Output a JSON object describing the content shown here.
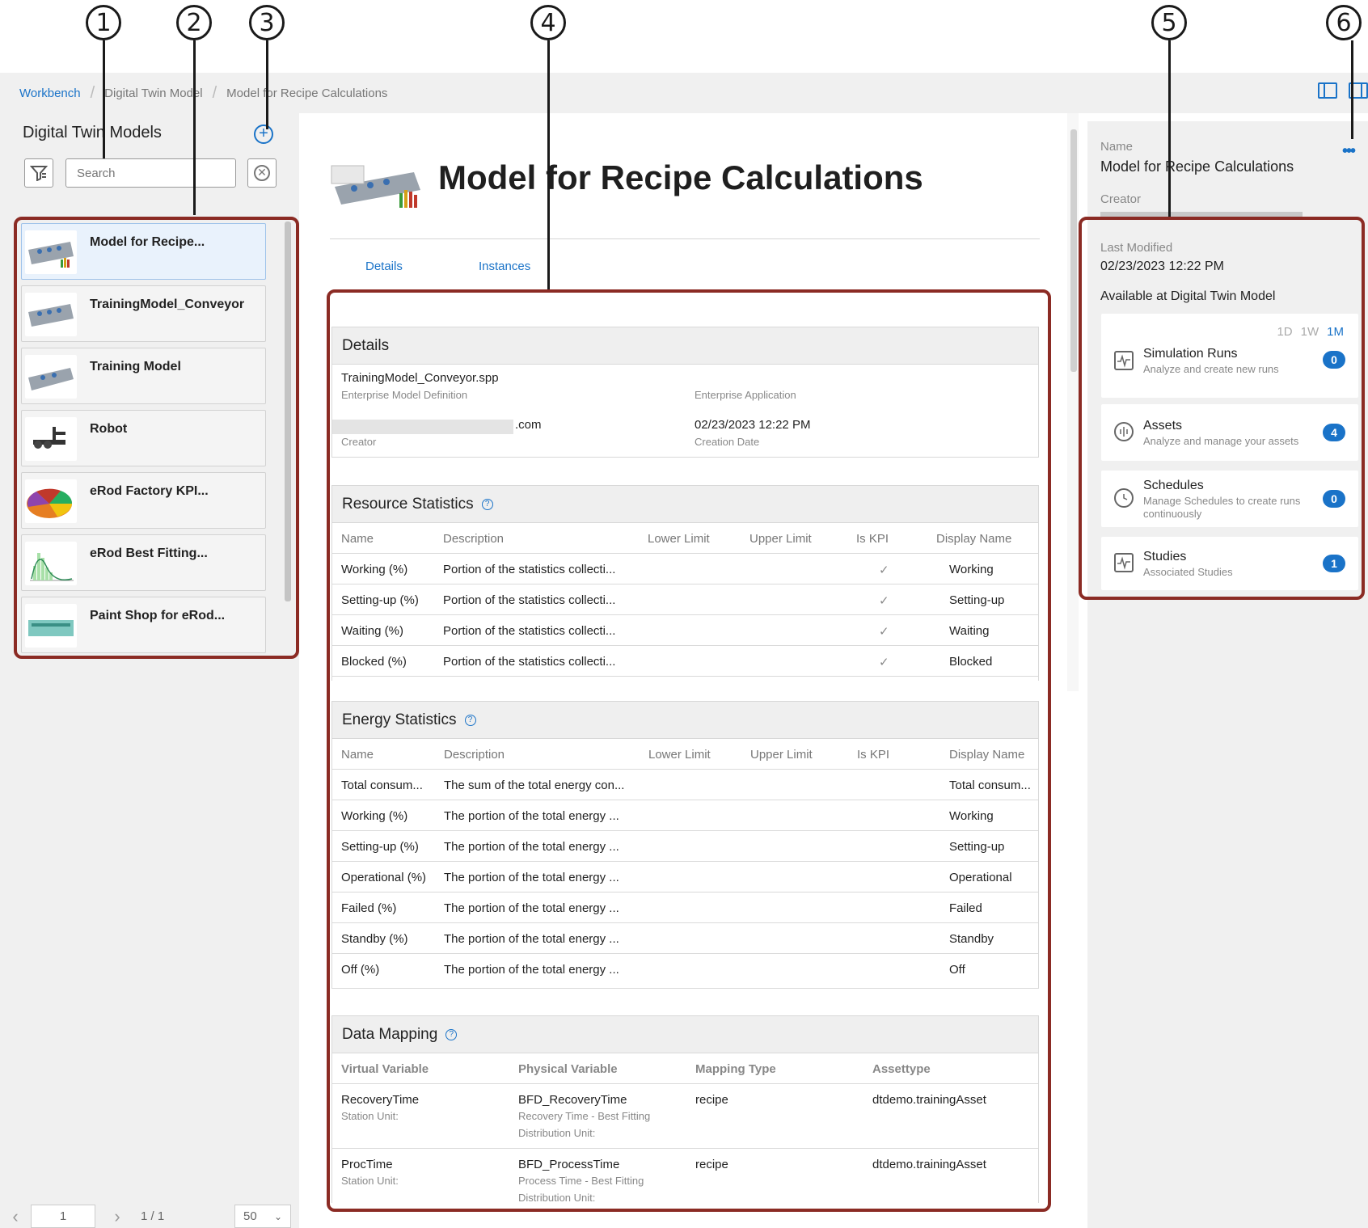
{
  "callouts": [
    "1",
    "2",
    "3",
    "4",
    "5",
    "6"
  ],
  "breadcrumb": [
    "Workbench",
    "Digital Twin Model",
    "Model for Recipe Calculations"
  ],
  "left": {
    "title": "Digital Twin Models",
    "search_placeholder": "Search",
    "models": [
      {
        "name": "Model for Recipe..."
      },
      {
        "name": "TrainingModel_Conveyor"
      },
      {
        "name": "Training Model"
      },
      {
        "name": "Robot"
      },
      {
        "name": "eRod Factory KPI..."
      },
      {
        "name": "eRod Best Fitting..."
      },
      {
        "name": "Paint Shop for eRod..."
      }
    ],
    "pager": {
      "page": "1",
      "of": "1 / 1",
      "per_page": "50"
    }
  },
  "main": {
    "title": "Model for Recipe Calculations",
    "tabs": [
      "Details",
      "Instances"
    ],
    "details": {
      "heading": "Details",
      "emd_value": "TrainingModel_Conveyor.spp",
      "emd_label": "Enterprise Model Definition",
      "ea_label": "Enterprise Application",
      "creator_value": ".com",
      "creator_label": "Creator",
      "created_value": "02/23/2023 12:22 PM",
      "created_label": "Creation Date"
    },
    "resource_stats": {
      "heading": "Resource Statistics",
      "columns": [
        "Name",
        "Description",
        "Lower Limit",
        "Upper Limit",
        "Is KPI",
        "Display Name"
      ],
      "rows": [
        {
          "name": "Working (%)",
          "desc": "Portion of the statistics collecti...",
          "kpi": "✓",
          "display": "Working"
        },
        {
          "name": "Setting-up (%)",
          "desc": "Portion of the statistics collecti...",
          "kpi": "✓",
          "display": "Setting-up"
        },
        {
          "name": "Waiting (%)",
          "desc": "Portion of the statistics collecti...",
          "kpi": "✓",
          "display": "Waiting"
        },
        {
          "name": "Blocked (%)",
          "desc": "Portion of the statistics collecti...",
          "kpi": "✓",
          "display": "Blocked"
        }
      ]
    },
    "energy_stats": {
      "heading": "Energy Statistics",
      "columns": [
        "Name",
        "Description",
        "Lower Limit",
        "Upper Limit",
        "Is KPI",
        "Display Name"
      ],
      "rows": [
        {
          "name": "Total consum...",
          "desc": "The sum of the total energy con...",
          "display": "Total consum..."
        },
        {
          "name": "Working (%)",
          "desc": "The portion of the total energy ...",
          "display": "Working"
        },
        {
          "name": "Setting-up (%)",
          "desc": "The portion of the total energy ...",
          "display": "Setting-up"
        },
        {
          "name": "Operational (%)",
          "desc": "The portion of the total energy ...",
          "display": "Operational"
        },
        {
          "name": "Failed (%)",
          "desc": "The portion of the total energy ...",
          "display": "Failed"
        },
        {
          "name": "Standby (%)",
          "desc": "The portion of the total energy ...",
          "display": "Standby"
        },
        {
          "name": "Off (%)",
          "desc": "The portion of the total energy ...",
          "display": "Off"
        }
      ]
    },
    "data_mapping": {
      "heading": "Data Mapping",
      "columns": [
        "Virtual Variable",
        "Physical Variable",
        "Mapping Type",
        "Assettype"
      ],
      "rows": [
        {
          "virtual": "RecoveryTime",
          "virtual_sub": "Station Unit:",
          "physical": "BFD_RecoveryTime",
          "physical_sub1": "Recovery Time - Best Fitting",
          "physical_sub2": "Distribution Unit:",
          "type": "recipe",
          "asset": "dtdemo.trainingAsset"
        },
        {
          "virtual": "ProcTime",
          "virtual_sub": "Station Unit:",
          "physical": "BFD_ProcessTime",
          "physical_sub1": "Process Time - Best Fitting",
          "physical_sub2": "Distribution Unit:",
          "type": "recipe",
          "asset": "dtdemo.trainingAsset"
        }
      ]
    }
  },
  "right": {
    "name_label": "Name",
    "name_value": "Model for Recipe Calculations",
    "creator_label": "Creator",
    "modified_label": "Last Modified",
    "modified_value": "02/23/2023 12:22 PM",
    "available_label": "Available at Digital Twin Model",
    "ranges": [
      "1D",
      "1W",
      "1M"
    ],
    "resources": [
      {
        "title": "Simulation Runs",
        "sub": "Analyze and create new runs",
        "count": "0"
      },
      {
        "title": "Assets",
        "sub": "Analyze and manage your assets",
        "count": "4"
      },
      {
        "title": "Schedules",
        "sub": "Manage Schedules to create runs continuously",
        "count": "0"
      },
      {
        "title": "Studies",
        "sub": "Associated Studies",
        "count": "1"
      }
    ]
  },
  "colors": {
    "accent": "#1a73c8",
    "frame": "#8b2b24"
  }
}
